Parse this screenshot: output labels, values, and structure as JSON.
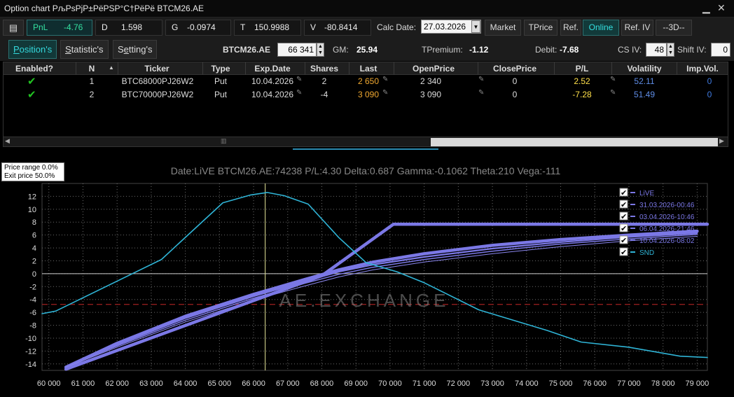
{
  "window": {
    "title": "Option chart РљРѕРјР±РёРЅР°С†РёРё BTCM26.AE"
  },
  "toolbar": {
    "pnl_label": "PnL",
    "pnl_value": "-4.76",
    "d_label": "D",
    "d_value": "1.598",
    "g_label": "G",
    "g_value": "-0.0974",
    "t_label": "T",
    "t_value": "150.9988",
    "v_label": "V",
    "v_value": "-80.8414",
    "calc_date_label": "Calc Date:",
    "calc_date_value": "27.03.2026",
    "buttons": [
      "Market",
      "TPrice",
      "Ref.",
      "Online",
      "Ref. IV",
      "--3D--"
    ]
  },
  "tabs": [
    {
      "pre": "",
      "ul": "P",
      "post": "osition's"
    },
    {
      "pre": "",
      "ul": "S",
      "post": "tatistic's"
    },
    {
      "pre": "S",
      "ul": "e",
      "post": "tting's"
    }
  ],
  "summary": {
    "ticker": "BTCM26.AE",
    "ticker_value": "66 341",
    "gm_label": "GM:",
    "gm_value": "25.94",
    "tpremium_label": "TPremium:",
    "tpremium_value": "-1.12",
    "debit_label": "Debit:",
    "debit_value": "-7.68",
    "csiv_label": "CS IV:",
    "csiv_value": "48",
    "shiftiv_label": "Shift IV:",
    "shiftiv_value": "0"
  },
  "table": {
    "headers": [
      "Enabled?",
      "N",
      "Ticker",
      "Type",
      "Exp.Date",
      "Shares",
      "Last",
      "OpenPrice",
      "ClosePrice",
      "P/L",
      "Volatility",
      "Imp.Vol."
    ],
    "rows": [
      {
        "n": "1",
        "ticker": "BTC68000PJ26W2",
        "type": "Put",
        "exp": "10.04.2026",
        "shares": "2",
        "last": "2 650",
        "open": "2 340",
        "close": "0",
        "pl": "2.52",
        "vol": "52.11",
        "impvol": "0"
      },
      {
        "n": "2",
        "ticker": "BTC70000PJ26W2",
        "type": "Put",
        "exp": "10.04.2026",
        "shares": "-4",
        "last": "3 090",
        "open": "3 090",
        "close": "0",
        "pl": "-7.28",
        "vol": "51.49",
        "impvol": "0"
      }
    ]
  },
  "info": {
    "price_range": "Price range 0.0%",
    "exit_price": "Exit price 50.0%"
  },
  "watermark": "AE.EXCHANGE",
  "colors": {
    "accent": "#34d8dc",
    "series_purple": "#7b78e6",
    "series_cyan": "#2fb4d6",
    "pnl_positive": "#ffe04a",
    "last_orange": "#f0a830",
    "vol_blue": "#5f8de6",
    "zero_blue": "#3f7ae0",
    "check_green": "#22c322"
  },
  "chart_data": {
    "type": "line",
    "title": "Date:LiVE  BTCM26.AE:74238  P/L:4.30  Delta:0.687  Gamma:-0.1062  Theta:210  Vega:-111",
    "xlim": [
      59800,
      79300
    ],
    "ylim": [
      -15,
      14
    ],
    "x_ticks": [
      60000,
      61000,
      62000,
      63000,
      64000,
      65000,
      66000,
      67000,
      68000,
      69000,
      70000,
      71000,
      72000,
      73000,
      74000,
      75000,
      76000,
      77000,
      78000,
      79000
    ],
    "x_tick_labels": [
      "60 000",
      "61 000",
      "62 000",
      "63 000",
      "64 000",
      "65 000",
      "66 000",
      "67 000",
      "68 000",
      "69 000",
      "70 000",
      "71 000",
      "72 000",
      "73 000",
      "74 000",
      "75 000",
      "76 000",
      "77 000",
      "78 000",
      "79 000"
    ],
    "y_ticks": [
      12,
      10,
      8,
      6,
      4,
      2,
      0,
      -2,
      -4,
      -6,
      -8,
      -10,
      -12,
      -14
    ],
    "current_price": 66341,
    "debit_line": -4.76,
    "grid": true,
    "legend_position": "top-right",
    "series": [
      {
        "name": "LiVE",
        "x": [
          60500,
          62000,
          64000,
          66000,
          67500,
          68500,
          69500,
          71000,
          73000,
          75000,
          77000,
          79000
        ],
        "y": [
          -14.5,
          -10.8,
          -6.6,
          -3.2,
          -0.9,
          0.6,
          1.8,
          3.1,
          4.4,
          5.3,
          6.0,
          6.6
        ]
      },
      {
        "name": "31.03.2026-00:46",
        "x": [
          60500,
          62000,
          64000,
          66000,
          67500,
          68500,
          69500,
          71000,
          73000,
          75000,
          77000,
          79000
        ],
        "y": [
          -14.5,
          -11.0,
          -6.9,
          -3.5,
          -1.2,
          0.3,
          1.4,
          2.6,
          3.9,
          4.9,
          5.7,
          6.3
        ]
      },
      {
        "name": "03.04.2026-10:46",
        "x": [
          60500,
          62000,
          64000,
          66000,
          67500,
          68500,
          69500,
          71000,
          73000,
          75000,
          77000,
          79000
        ],
        "y": [
          -14.5,
          -11.2,
          -7.2,
          -3.8,
          -1.5,
          -0.1,
          1.0,
          2.2,
          3.5,
          4.6,
          5.4,
          6.1
        ]
      },
      {
        "name": "06.04.2026-21:46",
        "x": [
          60500,
          62000,
          64000,
          66000,
          67500,
          68500,
          69500,
          71000,
          73000,
          75000,
          77000,
          79000
        ],
        "y": [
          -14.5,
          -11.4,
          -7.5,
          -4.1,
          -1.9,
          -0.5,
          0.6,
          1.8,
          3.1,
          4.2,
          5.1,
          5.8
        ]
      },
      {
        "name": "10.04.2026-08:02",
        "x": [
          60500,
          68000,
          70100,
          79300
        ],
        "y": [
          -14.8,
          -0.3,
          7.68,
          7.68
        ]
      },
      {
        "name": "SND",
        "x": [
          59800,
          60200,
          63300,
          65100,
          65900,
          66400,
          66900,
          67600,
          68500,
          69300,
          70200,
          71000,
          72600,
          74600,
          75600,
          77000,
          78500,
          79300
        ],
        "y": [
          -6.2,
          -5.8,
          2.2,
          11.0,
          12.2,
          12.6,
          12.1,
          10.8,
          5.6,
          1.7,
          0.3,
          -1.4,
          -5.6,
          -8.8,
          -10.6,
          -11.4,
          -12.8,
          -13.0
        ]
      }
    ]
  }
}
